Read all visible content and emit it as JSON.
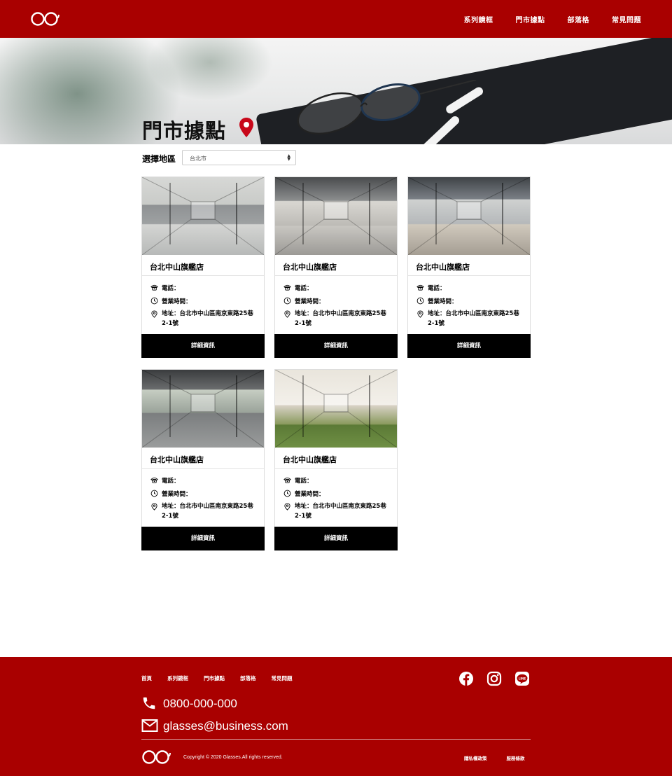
{
  "header": {
    "logo_name": "glasses-logo",
    "nav": [
      "系列鏡框",
      "門市據點",
      "部落格",
      "常見問題"
    ]
  },
  "hero": {
    "title": "門市據點"
  },
  "filter": {
    "label": "選擇地區",
    "selected": "台北市"
  },
  "stores": [
    {
      "name": "台北中山旗艦店",
      "phone_label": "電話：",
      "hours_label": "營業時間：",
      "address": "地址：台北市中山區南京東路25巷2-1號",
      "button": "詳細資訊"
    },
    {
      "name": "台北中山旗艦店",
      "phone_label": "電話：",
      "hours_label": "營業時間：",
      "address": "地址：台北市中山區南京東路25巷2-1號",
      "button": "詳細資訊"
    },
    {
      "name": "台北中山旗艦店",
      "phone_label": "電話：",
      "hours_label": "營業時間：",
      "address": "地址：台北市中山區南京東路25巷2-1號",
      "button": "詳細資訊"
    },
    {
      "name": "台北中山旗艦店",
      "phone_label": "電話：",
      "hours_label": "營業時間：",
      "address": "地址：台北市中山區南京東路25巷2-1號",
      "button": "詳細資訊"
    },
    {
      "name": "台北中山旗艦店",
      "phone_label": "電話：",
      "hours_label": "營業時間：",
      "address": "地址：台北市中山區南京東路25巷2-1號",
      "button": "詳細資訊"
    }
  ],
  "footer": {
    "nav": [
      "首頁",
      "系列鏡框",
      "門市據點",
      "部落格",
      "常見問題"
    ],
    "phone": "0800-000-000",
    "email": "glasses@business.com",
    "copyright": "Copyright © 2020 Glasses.All rights reserved.",
    "links": [
      "隱私權政策",
      "服務條款"
    ],
    "social": [
      "facebook-icon",
      "instagram-icon",
      "line-icon"
    ]
  },
  "colors": {
    "brand": "#a90000",
    "button": "#000000"
  }
}
